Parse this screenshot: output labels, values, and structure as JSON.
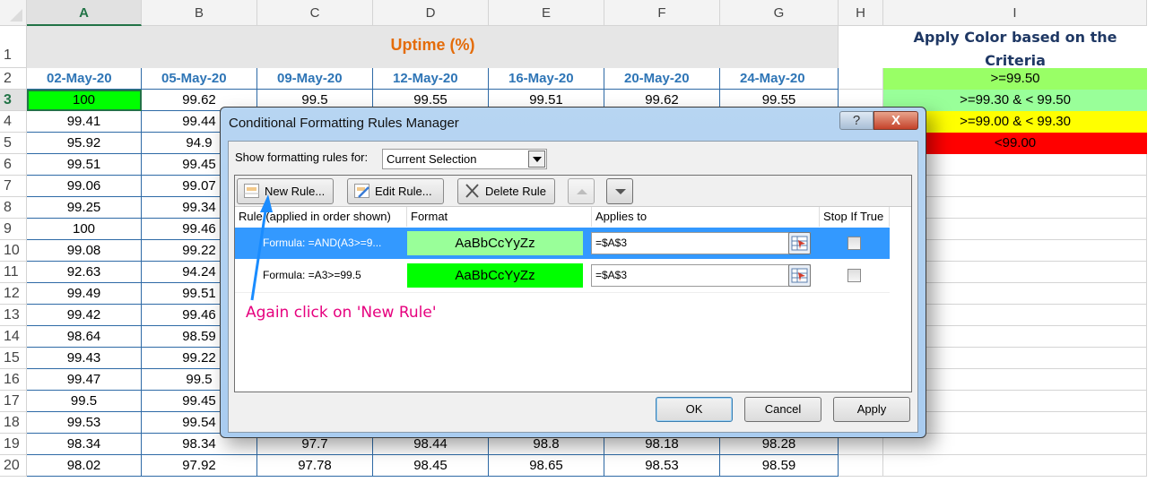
{
  "columns": [
    "A",
    "B",
    "C",
    "D",
    "E",
    "F",
    "G",
    "H",
    "I"
  ],
  "rows": [
    "1",
    "2",
    "3",
    "4",
    "5",
    "6",
    "7",
    "8",
    "9",
    "10",
    "11",
    "12",
    "13",
    "14",
    "15",
    "16",
    "17",
    "18",
    "19",
    "20"
  ],
  "selected_column": "A",
  "selected_row": "3",
  "sheet_title": "Uptime (%)",
  "dates": [
    "02-May-20",
    "05-May-20",
    "09-May-20",
    "12-May-20",
    "16-May-20",
    "20-May-20",
    "24-May-20"
  ],
  "col_a": [
    "100",
    "99.41",
    "95.92",
    "99.51",
    "99.06",
    "99.25",
    "100",
    "99.08",
    "92.63",
    "99.49",
    "99.42",
    "98.64",
    "99.43",
    "99.47",
    "99.5",
    "99.53",
    "98.34",
    "98.02"
  ],
  "col_b": [
    "99.62",
    "99.44",
    "94.9",
    "99.45",
    "99.07",
    "99.34",
    "99.46",
    "99.22",
    "94.24",
    "99.51",
    "99.46",
    "98.59",
    "99.22",
    "99.5",
    "99.45",
    "99.54",
    "98.34",
    "97.92"
  ],
  "row3": [
    "100",
    "99.62",
    "99.5",
    "99.55",
    "99.51",
    "99.62",
    "99.55"
  ],
  "row19": [
    "98.34",
    "98.34",
    "97.7",
    "98.44",
    "98.8",
    "98.18",
    "98.28"
  ],
  "row20": [
    "98.02",
    "97.92",
    "97.78",
    "98.45",
    "98.65",
    "98.53",
    "98.59"
  ],
  "legend": {
    "title": "Apply Color based on the Criteria",
    "items": [
      {
        "label": ">=99.50",
        "color": "#99ff66"
      },
      {
        "label": ">=99.30 & < 99.50",
        "color": "#99ff99"
      },
      {
        "label": ">=99.00 & < 99.30",
        "color": "#ffff00"
      },
      {
        "label": "<99.00",
        "color": "#ff0000"
      }
    ]
  },
  "highlight_color": "#00ff00",
  "dialog": {
    "title": "Conditional Formatting Rules Manager",
    "help": "?",
    "close": "X",
    "show_label": "Show formatting rules for:",
    "show_value": "Current Selection",
    "new_rule": "New Rule...",
    "edit_rule": "Edit Rule...",
    "delete_rule": "Delete Rule",
    "headers": {
      "rule": "Rule (applied in order shown)",
      "format": "Format",
      "applies": "Applies to",
      "stop": "Stop If True"
    },
    "rules": [
      {
        "name": "Formula: =AND(A3>=9...",
        "preview": "AaBbCcYyZz",
        "color": "#99ff99",
        "applies_to": "=$A$3",
        "stop": false,
        "selected": true
      },
      {
        "name": "Formula: =A3>=99.5",
        "preview": "AaBbCcYyZz",
        "color": "#00ff00",
        "applies_to": "=$A$3",
        "stop": false,
        "selected": false
      }
    ],
    "ok": "OK",
    "cancel": "Cancel",
    "apply": "Apply"
  },
  "annotation": "Again click on 'New Rule'"
}
